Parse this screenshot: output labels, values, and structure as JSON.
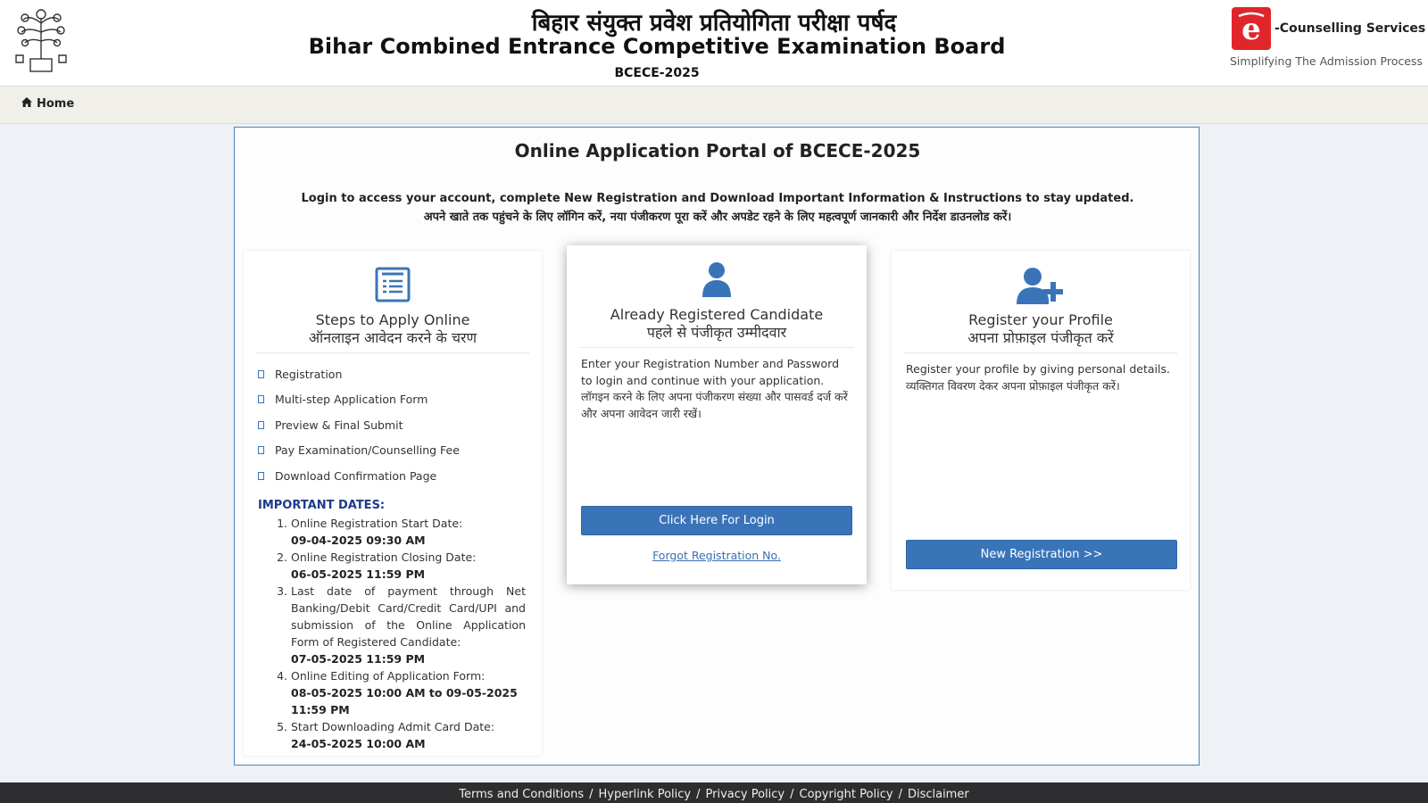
{
  "header": {
    "title_hi": "बिहार संयुक्त प्रवेश प्रतियोगिता परीक्षा पर्षद",
    "title_en": "Bihar Combined Entrance Competitive Examination Board",
    "exam_year": "BCECE-2025",
    "emblem_icon": "bihar-state-emblem-icon",
    "partner_brand": "-Counselling Services",
    "partner_tagline": "Simplifying The Admission Process",
    "partner_logo_icon": "e-counselling-logo-icon"
  },
  "nav": {
    "home_label": "Home",
    "home_icon": "home-icon"
  },
  "portal": {
    "title": "Online Application Portal of BCECE-2025",
    "subtitle_en": "Login to access your account, complete New Registration and Download Important Information & Instructions to stay updated.",
    "subtitle_hi": "अपने खाते तक पहुंचने के लिए लॉगिन करें, नया पंजीकरण पूरा करें और अपडेट रहने के लिए महत्वपूर्ण जानकारी और निर्देश डाउनलोड करें।"
  },
  "steps_card": {
    "icon": "checklist-icon",
    "title_en": "Steps to Apply Online",
    "title_hi": "ऑनलाइन आवेदन करने के चरण",
    "steps": [
      "Registration",
      "Multi-step Application Form",
      "Preview & Final Submit",
      "Pay Examination/Counselling Fee",
      "Download Confirmation Page"
    ],
    "dates_heading": "IMPORTANT DATES:",
    "dates": [
      {
        "num": "1.",
        "label": "Online Registration Start Date:",
        "value": "09-04-2025 09:30 AM"
      },
      {
        "num": "2.",
        "label": "Online Registration Closing Date:",
        "value": "06-05-2025 11:59 PM"
      },
      {
        "num": "3.",
        "label": "Last date of payment through Net Banking/Debit Card/Credit Card/UPI and submission of the Online Application Form of Registered Candidate:",
        "value": "07-05-2025 11:59 PM"
      },
      {
        "num": "4.",
        "label": "Online Editing of Application Form:",
        "value": "08-05-2025 10:00 AM to 09-05-2025 11:59 PM"
      },
      {
        "num": "5.",
        "label": "Start Downloading Admit Card Date:",
        "value": "24-05-2025 10:00 AM"
      }
    ]
  },
  "login_card": {
    "icon": "user-icon",
    "title_en": "Already Registered Candidate",
    "title_hi": "पहले से पंजीकृत उम्मीदवार",
    "body_en": "Enter your Registration Number and Password to login and continue with your application.",
    "body_hi": "लॉगइन करने के लिए अपना पंजीकरण संख्या और पासवर्ड दर्ज करें और अपना आवेदन जारी रखें।",
    "button_label": "Click Here For Login",
    "forgot_label": "Forgot Registration No."
  },
  "register_card": {
    "icon": "add-user-icon",
    "title_en": "Register your Profile",
    "title_hi": "अपना प्रोफ़ाइल पंजीकृत करें",
    "body_en": "Register your profile by giving personal details.",
    "body_hi": "व्यक्तिगत विवरण देकर अपना प्रोफ़ाइल पंजीकृत करें।",
    "button_label": "New Registration >>"
  },
  "footer": {
    "links": [
      "Terms and Conditions",
      "Hyperlink Policy",
      "Privacy Policy",
      "Copyright Policy",
      "Disclaimer"
    ],
    "separator": "/"
  },
  "colors": {
    "accent_blue": "#3a74b8",
    "panel_border": "#4a82bf",
    "dates_heading": "#1f3a8a",
    "footer_bg": "#2e2e30",
    "partner_red": "#e0262b"
  }
}
